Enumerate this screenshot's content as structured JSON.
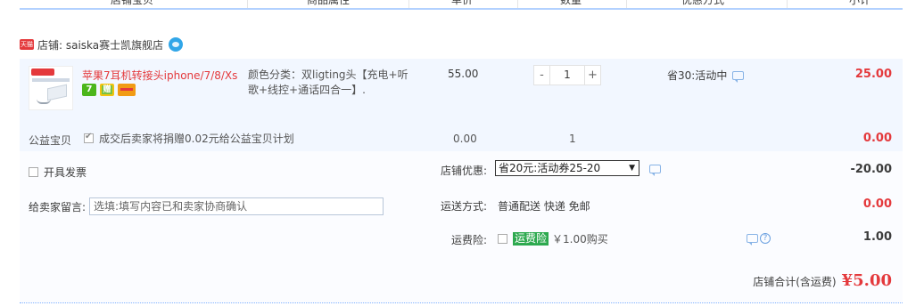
{
  "table_header": {
    "columns": [
      "店铺宝贝",
      "商品属性",
      "单价",
      "数量",
      "优惠方式",
      "小计"
    ]
  },
  "shop": {
    "badge_text": "天猫",
    "label": "店铺: saiska赛士凯旗舰店",
    "icon": "wangwang-chat-icon"
  },
  "item": {
    "title": "苹果7耳机转接头iphone/7/8/Xs ...",
    "badges": [
      "7",
      "赠",
      "card"
    ],
    "sku": "颜色分类：双ligting头【充电+听歌+线控+通话四合一】.",
    "unit_price": "55.00",
    "quantity": "1",
    "qty_minus": "-",
    "qty_plus": "+",
    "promo": "省30:活动中",
    "subtotal": "25.00"
  },
  "charity": {
    "label": "公益宝贝",
    "text": "成交后卖家将捐赠0.02元给公益宝贝计划",
    "price": "0.00",
    "quantity": "1",
    "total": "0.00"
  },
  "invoice": {
    "label": "开具发票"
  },
  "memo": {
    "label": "给卖家留言:",
    "placeholder": "选填:填写内容已和卖家协商确认"
  },
  "shop_discount": {
    "label": "店铺优惠:",
    "selected": "省20元:活动券25-20",
    "amount": "-20.00"
  },
  "shipping": {
    "label": "运送方式:",
    "method": "普通配送 快递 免邮",
    "amount": "0.00"
  },
  "insurance": {
    "label": "运费险:",
    "tag": "运费险",
    "price": "￥1.00购买",
    "amount": "1.00"
  },
  "total": {
    "label": "店铺合计(含运费)",
    "value": "¥5.00"
  },
  "colors": {
    "accent_red": "#e4393c",
    "row_blue": "#f2f7ff",
    "header_line": "#b2d1ff"
  }
}
